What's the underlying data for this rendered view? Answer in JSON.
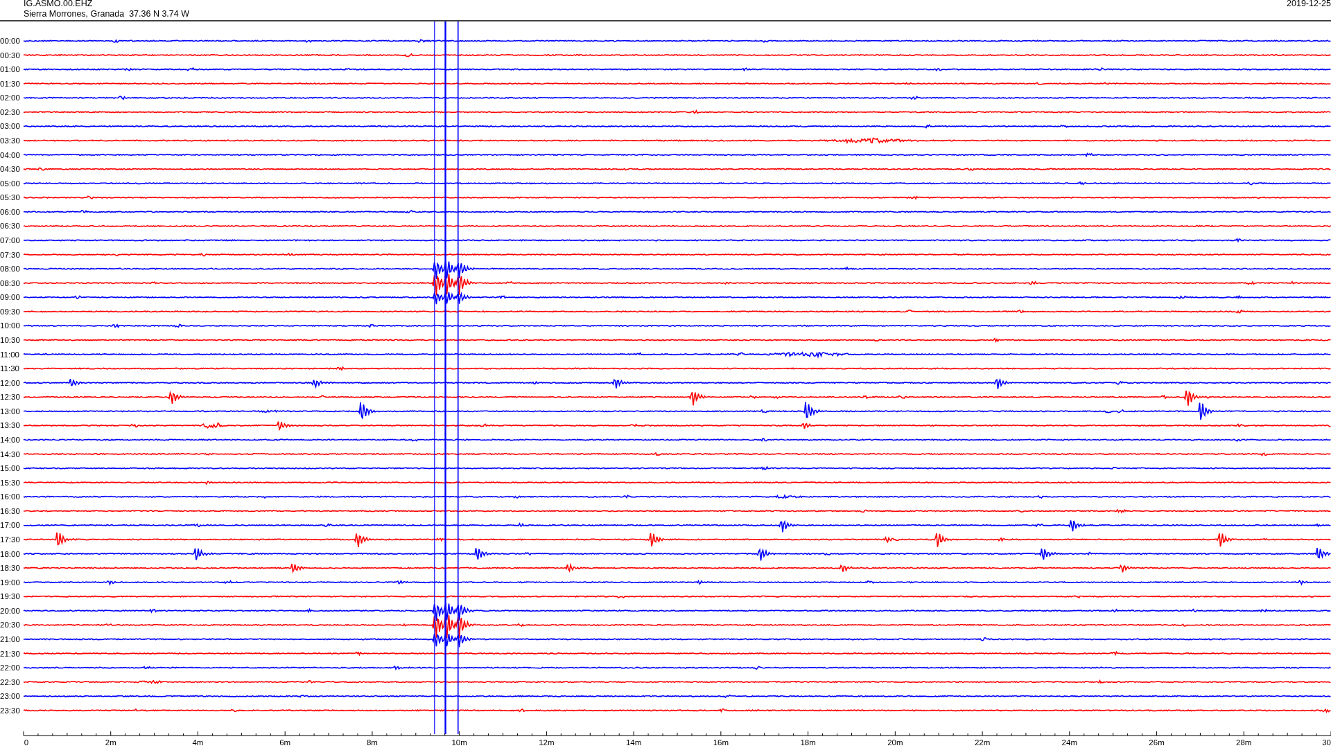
{
  "header": {
    "station": "IG.ASMO.00.EHZ",
    "location": "Sierra Morrones, Granada  37.36 N 3.74 W",
    "date": "2019-12-25"
  },
  "rows": [
    {
      "label": "00:00",
      "color": "#0000ff"
    },
    {
      "label": "00:30",
      "color": "#ff0000"
    },
    {
      "label": "01:00",
      "color": "#0000ff"
    },
    {
      "label": "01:30",
      "color": "#ff0000"
    },
    {
      "label": "02:00",
      "color": "#0000ff"
    },
    {
      "label": "02:30",
      "color": "#ff0000"
    },
    {
      "label": "03:00",
      "color": "#0000ff"
    },
    {
      "label": "03:30",
      "color": "#ff0000"
    },
    {
      "label": "04:00",
      "color": "#0000ff"
    },
    {
      "label": "04:30",
      "color": "#ff0000"
    },
    {
      "label": "05:00",
      "color": "#0000ff"
    },
    {
      "label": "05:30",
      "color": "#ff0000"
    },
    {
      "label": "06:00",
      "color": "#0000ff"
    },
    {
      "label": "06:30",
      "color": "#ff0000"
    },
    {
      "label": "07:00",
      "color": "#0000ff"
    },
    {
      "label": "07:30",
      "color": "#ff0000"
    },
    {
      "label": "08:00",
      "color": "#0000ff"
    },
    {
      "label": "08:30",
      "color": "#ff0000"
    },
    {
      "label": "09:00",
      "color": "#0000ff"
    },
    {
      "label": "09:30",
      "color": "#ff0000"
    },
    {
      "label": "10:00",
      "color": "#0000ff"
    },
    {
      "label": "10:30",
      "color": "#ff0000"
    },
    {
      "label": "11:00",
      "color": "#0000ff"
    },
    {
      "label": "11:30",
      "color": "#ff0000"
    },
    {
      "label": "12:00",
      "color": "#0000ff"
    },
    {
      "label": "12:30",
      "color": "#ff0000"
    },
    {
      "label": "13:00",
      "color": "#0000ff"
    },
    {
      "label": "13:30",
      "color": "#ff0000"
    },
    {
      "label": "14:00",
      "color": "#0000ff"
    },
    {
      "label": "14:30",
      "color": "#ff0000"
    },
    {
      "label": "15:00",
      "color": "#0000ff"
    },
    {
      "label": "15:30",
      "color": "#ff0000"
    },
    {
      "label": "16:00",
      "color": "#0000ff"
    },
    {
      "label": "16:30",
      "color": "#ff0000"
    },
    {
      "label": "17:00",
      "color": "#0000ff"
    },
    {
      "label": "17:30",
      "color": "#ff0000"
    },
    {
      "label": "18:00",
      "color": "#0000ff"
    },
    {
      "label": "18:30",
      "color": "#ff0000"
    },
    {
      "label": "19:00",
      "color": "#0000ff"
    },
    {
      "label": "19:30",
      "color": "#ff0000"
    },
    {
      "label": "20:00",
      "color": "#0000ff"
    },
    {
      "label": "20:30",
      "color": "#ff0000"
    },
    {
      "label": "21:00",
      "color": "#0000ff"
    },
    {
      "label": "21:30",
      "color": "#ff0000"
    },
    {
      "label": "22:00",
      "color": "#0000ff"
    },
    {
      "label": "22:30",
      "color": "#ff0000"
    },
    {
      "label": "23:00",
      "color": "#0000ff"
    },
    {
      "label": "23:30",
      "color": "#ff0000"
    }
  ],
  "x_axis": {
    "ticks": [
      "0",
      "2m",
      "4m",
      "6m",
      "8m",
      "10m",
      "12m",
      "14m",
      "16m",
      "18m",
      "20m",
      "22m",
      "24m",
      "26m",
      "28m",
      "30"
    ]
  }
}
